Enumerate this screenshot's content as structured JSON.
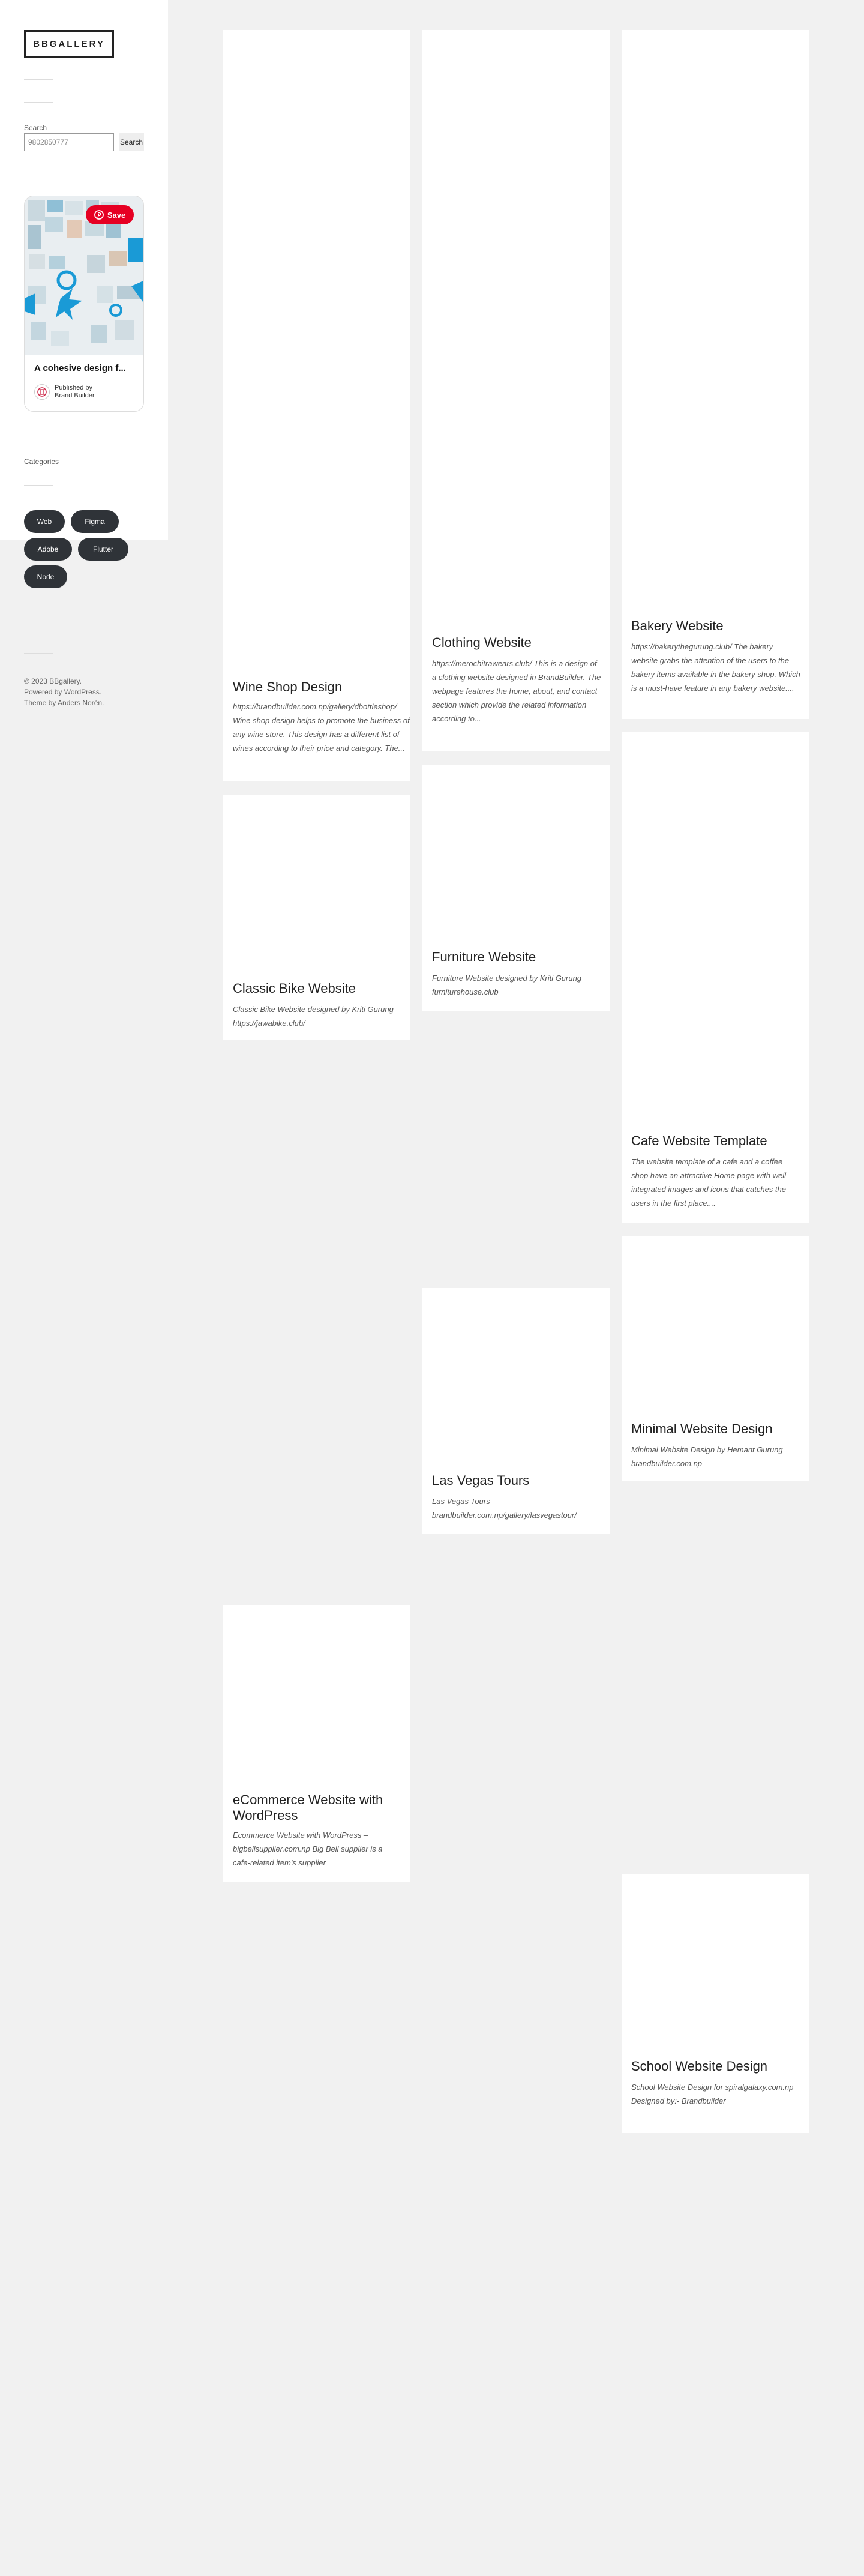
{
  "site": {
    "logo": "BBGALLERY"
  },
  "search": {
    "label": "Search",
    "value": "9802850777",
    "button": "Search"
  },
  "pin": {
    "save_label": "Save",
    "title": "A cohesive design f...",
    "published_by_label": "Published by",
    "publisher": "Brand Builder",
    "brand_color": "#e60023"
  },
  "categories": {
    "title": "Categories",
    "tags": [
      "Web",
      "Figma",
      "Adobe",
      "Flutter",
      "Node"
    ]
  },
  "footer": {
    "copyright": "© 2023 BBgallery.",
    "powered": "Powered by WordPress.",
    "theme": "Theme by Anders Norén."
  },
  "posts": [
    {
      "title": "Wine Shop Design",
      "excerpt": "https://brandbuilder.com.np/gallery/dbottleshop/ Wine shop design helps to promote the business of any wine store. This design has a different list of wines according to their price and category. The..."
    },
    {
      "title": "Clothing Website",
      "excerpt": "https://merochitrawears.club/ This is a design of a clothing website designed in BrandBuilder. The webpage features the home, about, and contact section which provide the related information according to..."
    },
    {
      "title": "Bakery Website",
      "excerpt": "https://bakerythegurung.club/ The bakery website grabs the attention of the users to the bakery items available in the bakery shop. Which is a must-have feature in any bakery website...."
    },
    {
      "title": "Classic Bike Website",
      "excerpt": "Classic Bike Website designed by Kriti Gurung https://jawabike.club/"
    },
    {
      "title": "Furniture Website",
      "excerpt": "Furniture Website designed by Kriti Gurung furniturehouse.club"
    },
    {
      "title": "Cafe Website Template",
      "excerpt": "The website template of a cafe and a coffee shop have an attractive Home page with well-integrated images and icons that catches the users in the first place...."
    },
    {
      "title": "Minimal Website Design",
      "excerpt": "Minimal Website Design by Hemant Gurung brandbuilder.com.np"
    },
    {
      "title": "Las Vegas Tours",
      "excerpt": "Las Vegas Tours brandbuilder.com.np/gallery/lasvegastour/"
    },
    {
      "title": "eCommerce Website with WordPress",
      "excerpt": "Ecommerce Website with WordPress – bigbellsupplier.com.np Big Bell supplier is a cafe-related item's supplier"
    },
    {
      "title": "School Website Design",
      "excerpt": "School Website Design for spiralgalaxy.com.np Designed by:- Brandbuilder"
    }
  ]
}
